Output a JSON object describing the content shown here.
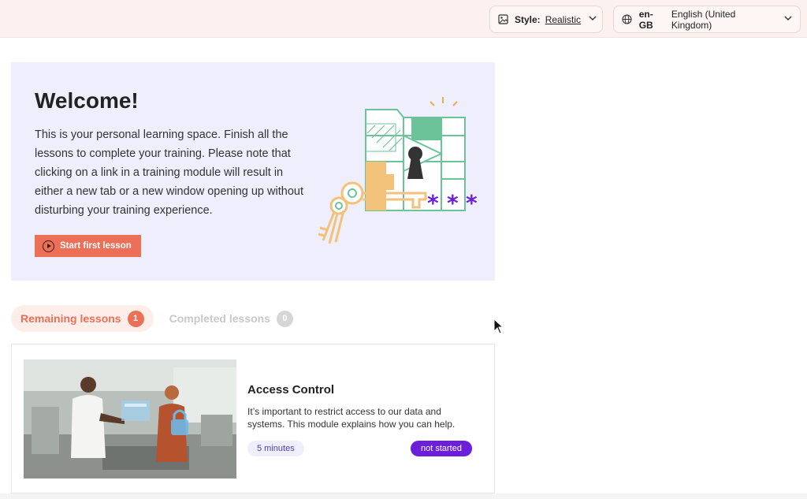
{
  "topbar": {
    "style_label": "Style:",
    "style_value": "Realistic",
    "lang_code": "en-GB",
    "lang_name": "English (United Kingdom)"
  },
  "hero": {
    "title": "Welcome!",
    "body": "This is your personal learning space. Finish all the lessons to complete your training. Please note that clicking on a link in a training module will result in either a new tab or a new window opening up without disturbing your training experience.",
    "button_label": "Start first lesson"
  },
  "tabs": [
    {
      "label": "Remaining lessons",
      "count": "1",
      "active": true
    },
    {
      "label": "Completed lessons",
      "count": "0",
      "active": false
    }
  ],
  "lesson": {
    "title": "Access Control",
    "description": "It’s important to restrict access to our data and systems. This module explains how you can help.",
    "duration": "5 minutes",
    "status": "not started"
  },
  "icons": [
    "image-icon",
    "globe-icon",
    "chevron-down-icon",
    "play-icon",
    "cursor-icon"
  ],
  "colors": {
    "accent": "#ec6f57",
    "status": "#6b1fd8",
    "hero_bg": "#eeeefc",
    "topbar_bg": "#fdf1ef"
  }
}
